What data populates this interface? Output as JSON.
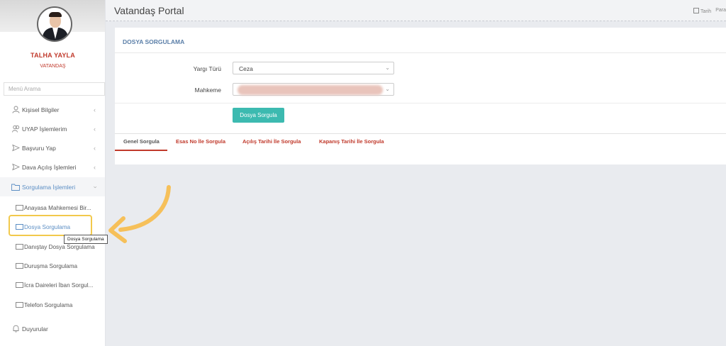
{
  "profile": {
    "name": "TALHA YAYLA",
    "role": "VATANDAŞ"
  },
  "menu_search": {
    "placeholder": "Menü Arama"
  },
  "menu": [
    {
      "label": "Kişisel Bilgiler",
      "icon": "user-icon"
    },
    {
      "label": "UYAP İşlemlerim",
      "icon": "users-icon"
    },
    {
      "label": "Başvuru Yap",
      "icon": "send-icon"
    },
    {
      "label": "Dava Açılış İşlemleri",
      "icon": "send-icon"
    },
    {
      "label": "Sorgulama İşlemleri",
      "icon": "folder-icon",
      "active": true
    }
  ],
  "submenu": [
    "Anayasa Mahkemesi Bir...",
    "Dosya Sorgulama",
    "Danıştay Dosya Sorgulama",
    "Duruşma Sorgulama",
    "İcra Daireleri İban Sorgul...",
    "Telefon Sorgulama"
  ],
  "duyurular": "Duyurular",
  "tooltip": "Dosya Sorgulama",
  "header": {
    "title": "Vatandaş Portal",
    "right_items": [
      "Tarih",
      "Para"
    ]
  },
  "panel": {
    "title": "DOSYA SORGULAMA",
    "yargi_label": "Yargı Türü",
    "yargi_value": "Ceza",
    "mahkeme_label": "Mahkeme",
    "button": "Dosya Sorgula",
    "tabs": [
      "Genel Sorgula",
      "Esas No İle Sorgula",
      "Açılış Tarihi İle Sorgula",
      "Kapanış Tarihi İle Sorgula"
    ]
  },
  "colors": {
    "accent": "#3cbab0",
    "brand_red": "#c0392b",
    "highlight": "#f2c94c",
    "arrow": "#f6c05a"
  }
}
